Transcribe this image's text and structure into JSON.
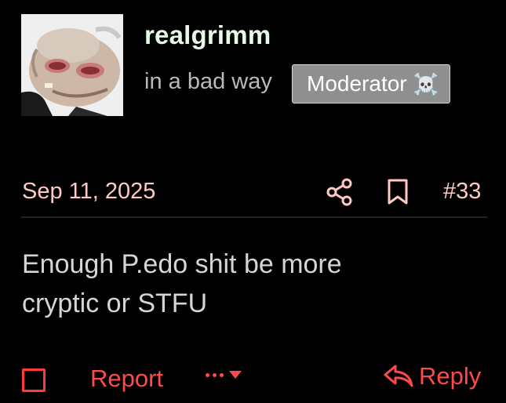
{
  "author": {
    "username": "realgrimm",
    "user_title": "in a bad way",
    "badge_label": "Moderator",
    "badge_emoji": "☠️",
    "avatar_icon": "puppet-face-avatar"
  },
  "post": {
    "date": "Sep 11, 2025",
    "number": "#33",
    "body_line1": "Enough P.edo shit be more",
    "body_line2": "cryptic or STFU"
  },
  "actions": {
    "share_icon": "share-icon",
    "bookmark_icon": "bookmark-icon",
    "report_label": "Report",
    "reply_label": "Reply",
    "more_icon": "ellipsis-chevron-icon"
  },
  "colors": {
    "background": "#000000",
    "username": "#e6f8e6",
    "accent": "#ff4a4a",
    "meta": "#ffc9c1",
    "badge_bg": "#8f8f8f"
  }
}
